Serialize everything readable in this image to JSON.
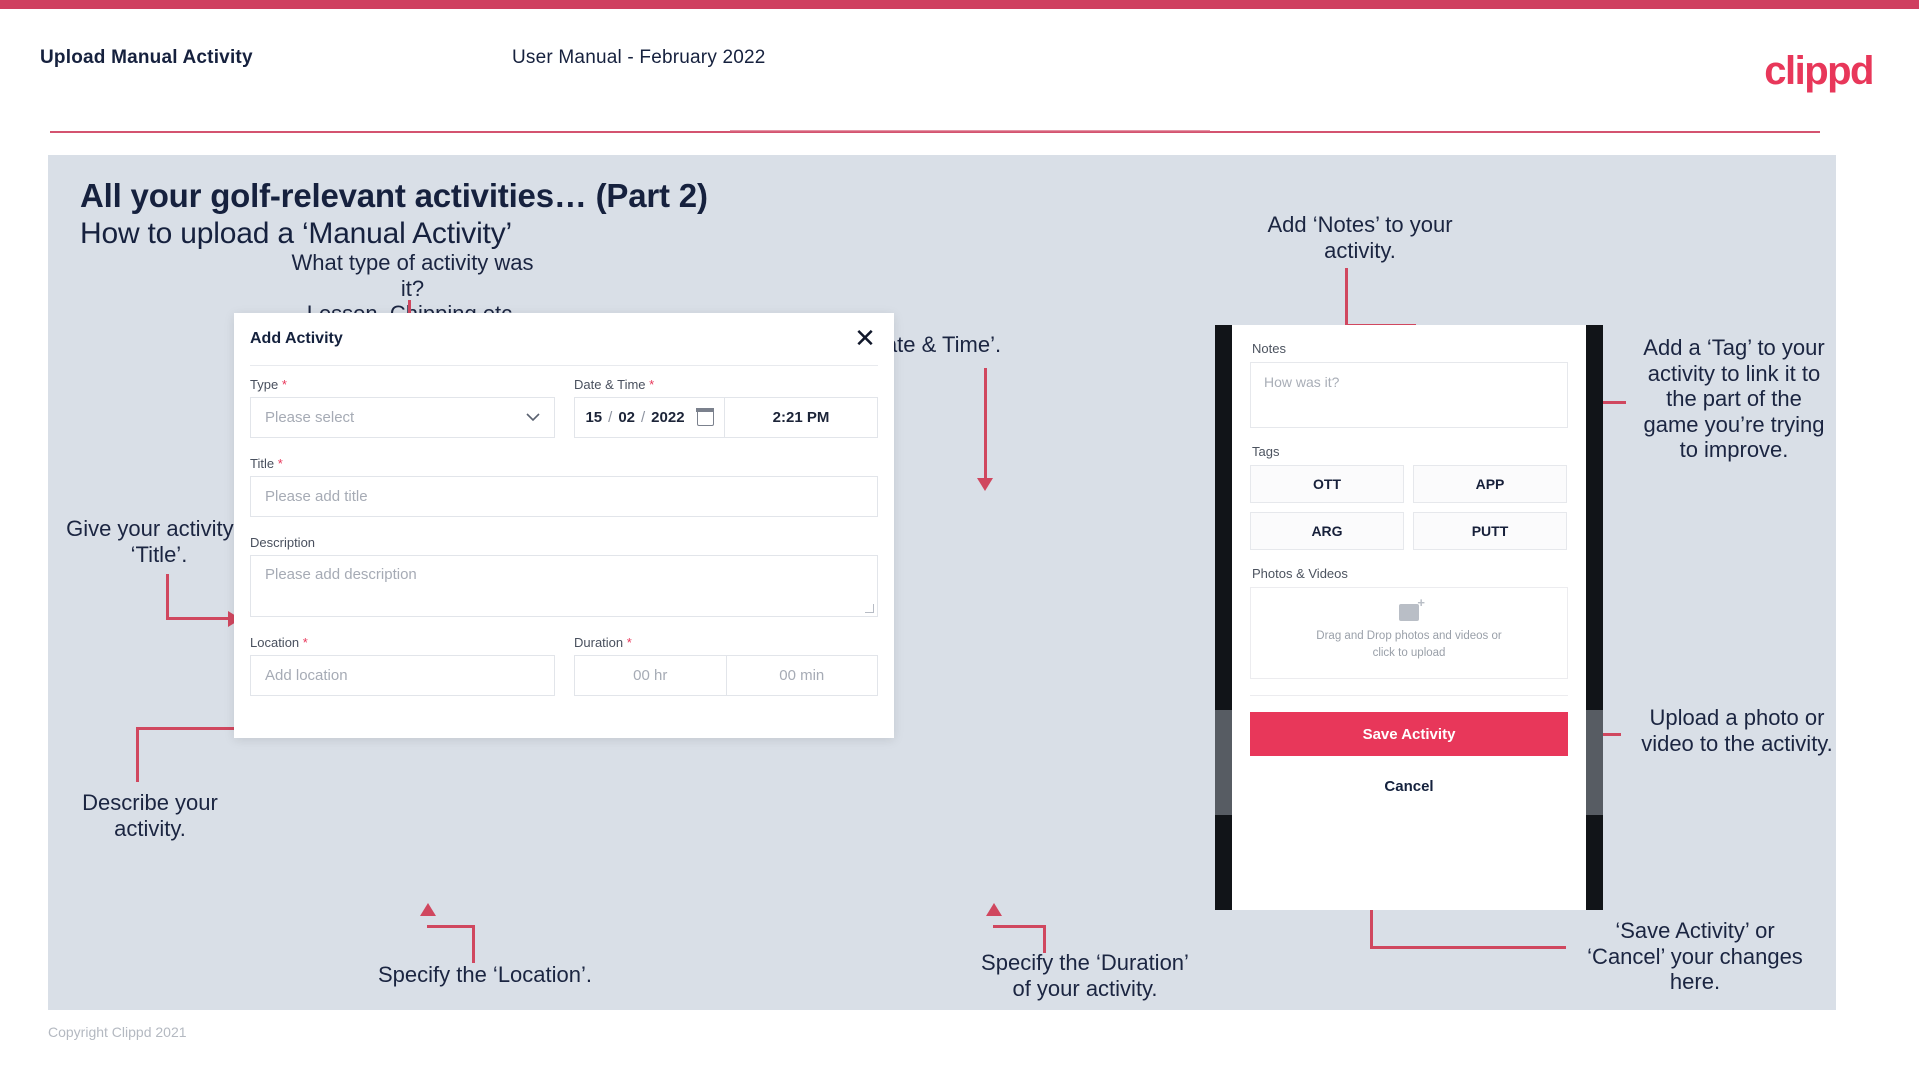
{
  "header": {
    "title": "Upload Manual Activity",
    "subtitle": "User Manual - February 2022",
    "logo": "clippd"
  },
  "slide": {
    "title": "All your golf-relevant activities… (Part 2)",
    "subtitle": "How to upload a ‘Manual Activity’"
  },
  "annotations": {
    "type": "What type of activity was it?\nLesson, Chipping etc.",
    "date_time": "Add ‘Date & Time’.",
    "notes": "Add ‘Notes’ to your\nactivity.",
    "tag": "Add a ‘Tag’ to your\nactivity to link it to\nthe part of the\ngame you’re trying\nto improve.",
    "title": "Give your activity a\n‘Title’.",
    "describe": "Describe your\nactivity.",
    "location": "Specify the ‘Location’.",
    "duration": "Specify the ‘Duration’\nof your activity.",
    "upload": "Upload a photo or\nvideo to the activity.",
    "save_cancel": "‘Save Activity’ or\n‘Cancel’ your changes\nhere."
  },
  "modal": {
    "title": "Add Activity",
    "close_icon": "✕",
    "fields": {
      "type": {
        "label": "Type",
        "required": "*",
        "placeholder": "Please select",
        "chevron": "⌄"
      },
      "datetime": {
        "label": "Date & Time",
        "required": "*",
        "day": "15",
        "month": "02",
        "year": "2022",
        "sep": "/",
        "time": "2:21 PM"
      },
      "title": {
        "label": "Title",
        "required": "*",
        "placeholder": "Please add title"
      },
      "description": {
        "label": "Description",
        "required": "",
        "placeholder": "Please add description"
      },
      "location": {
        "label": "Location",
        "required": "*",
        "placeholder": "Add location"
      },
      "duration": {
        "label": "Duration",
        "required": "*",
        "hours": "00 hr",
        "minutes": "00 min"
      }
    }
  },
  "phone": {
    "notes": {
      "label": "Notes",
      "placeholder": "How was it?"
    },
    "tags": {
      "label": "Tags",
      "items": [
        "OTT",
        "APP",
        "ARG",
        "PUTT"
      ]
    },
    "photos": {
      "label": "Photos & Videos",
      "dropzone_line1": "Drag and Drop photos and videos or",
      "dropzone_line2": "click to upload"
    },
    "save_label": "Save Activity",
    "cancel_label": "Cancel"
  },
  "footer": {
    "copyright": "Copyright Clippd 2021"
  },
  "colors": {
    "brand_pink": "#e8375a",
    "accent_line": "#d0475f",
    "slide_bg": "#d9dfe7",
    "text_dark": "#16213e"
  }
}
